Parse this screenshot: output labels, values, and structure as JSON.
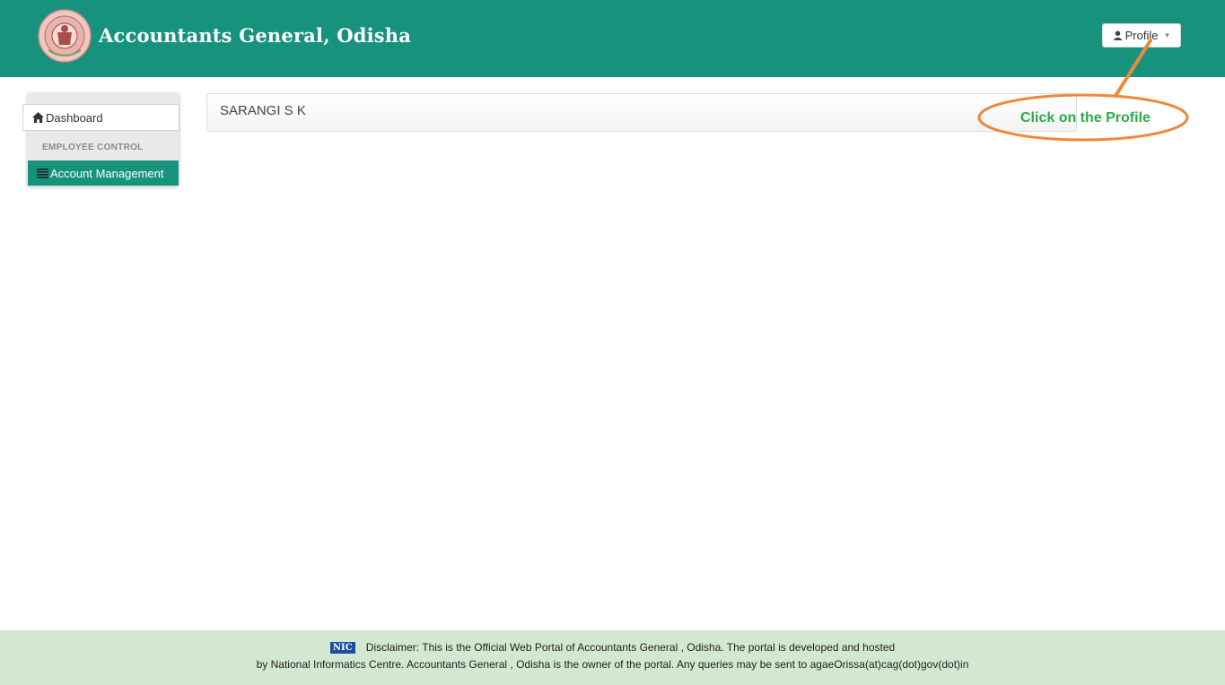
{
  "header": {
    "title": "Accountants General, Odisha",
    "profile_label": "Profile"
  },
  "sidebar": {
    "dashboard_label": "Dashboard",
    "section_header": "EMPLOYEE CONTROL",
    "account_management_label": "Account Management"
  },
  "main": {
    "user_name": "SARANGI S K"
  },
  "annotation": {
    "text": "Click on the Profile",
    "color": "#f0883a"
  },
  "footer": {
    "logo_text": "NIC",
    "line1": "Disclaimer: This is the Official Web Portal of Accountants General , Odisha. The portal is developed and hosted",
    "line2": "by National Informatics Centre. Accountants General , Odisha is the owner of the portal. Any queries may be sent to agaeOrissa(at)cag(dot)gov(dot)in"
  },
  "colors": {
    "header_bg": "#17937d",
    "footer_bg": "#d3e8d1"
  }
}
